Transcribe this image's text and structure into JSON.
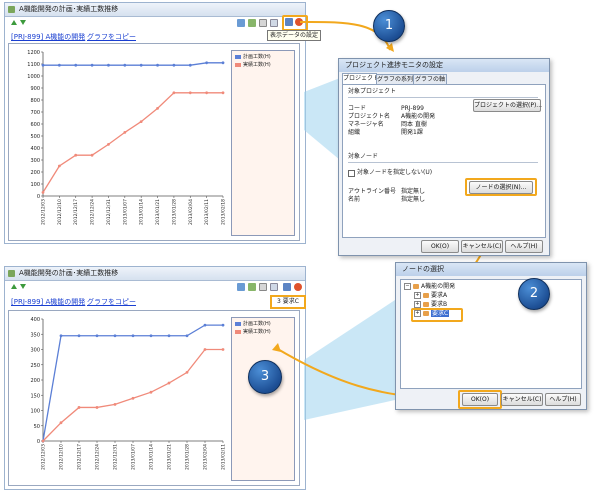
{
  "panel1": {
    "title": "A機能開発の計画･実績工数推移",
    "link_prj": "[PRJ-899] A機能の開発",
    "link_copy": "グラフをコピー",
    "tooltip": "表示データの設定"
  },
  "panel2": {
    "title": "A機能開発の計画･実績工数推移",
    "link_prj": "[PRJ-899] A機能の開発",
    "link_copy": "グラフをコピー",
    "node_badge": "3 要求C"
  },
  "chart_data": [
    {
      "type": "line",
      "x": [
        "2012/12/03",
        "2012/12/10",
        "2012/12/17",
        "2012/12/24",
        "2012/12/31",
        "2013/01/07",
        "2013/01/14",
        "2013/01/21",
        "2013/01/28",
        "2013/02/04",
        "2013/02/11",
        "2013/02/18"
      ],
      "series": [
        {
          "name": "計画工数(H)",
          "color": "#5b7fd6",
          "values": [
            1090,
            1090,
            1090,
            1090,
            1090,
            1090,
            1090,
            1090,
            1090,
            1090,
            1110,
            1110
          ]
        },
        {
          "name": "実績工数(H)",
          "color": "#f08a7a",
          "values": [
            30,
            250,
            340,
            340,
            430,
            530,
            620,
            730,
            860,
            860,
            860,
            860
          ]
        }
      ],
      "ylim": [
        0,
        1200
      ],
      "yticks": [
        "0",
        "100",
        "200",
        "300",
        "400",
        "500",
        "600",
        "700",
        "800",
        "900",
        "1000",
        "1100",
        "1200"
      ],
      "legend": "right",
      "grid": false
    },
    {
      "type": "line",
      "x": [
        "2012/12/03",
        "2012/12/10",
        "2012/12/17",
        "2012/12/24",
        "2012/12/31",
        "2013/01/07",
        "2013/01/14",
        "2013/01/21",
        "2013/01/28",
        "2013/02/04",
        "2013/02/11"
      ],
      "series": [
        {
          "name": "計画工数(H)",
          "color": "#5b7fd6",
          "values": [
            0,
            345,
            345,
            345,
            345,
            345,
            345,
            345,
            345,
            380,
            380
          ]
        },
        {
          "name": "実績工数(H)",
          "color": "#f08a7a",
          "values": [
            0,
            60,
            110,
            110,
            120,
            140,
            160,
            190,
            225,
            300,
            300
          ]
        }
      ],
      "ylim": [
        0,
        400
      ],
      "yticks": [
        "0",
        "50",
        "100",
        "150",
        "200",
        "250",
        "300",
        "350",
        "400"
      ],
      "legend": "right",
      "grid": false
    }
  ],
  "dialog_settings": {
    "title": "プロジェクト進捗モニタの設定",
    "tabs": [
      "プロジェクト",
      "グラフの系列",
      "グラフの軸"
    ],
    "section_project": "対象プロジェクト",
    "select_project_btn": "プロジェクトの選択(P)...",
    "rows": [
      {
        "label": "コード",
        "value": "PRJ-899"
      },
      {
        "label": "プロジェクト名",
        "value": "A機能の開発"
      },
      {
        "label": "マネージャ名",
        "value": "岡本 直樹"
      },
      {
        "label": "組織",
        "value": "開発1課"
      }
    ],
    "section_node": "対象ノード",
    "no_node_checkbox": "対象ノードを指定しない(U)",
    "node_rows": [
      {
        "label": "アウトライン番号",
        "value": "指定無し"
      },
      {
        "label": "名前",
        "value": "指定無し"
      }
    ],
    "select_node_btn": "ノードの選択(N)...",
    "ok": "OK(O)",
    "cancel": "キャンセル(C)",
    "help": "ヘルプ(H)"
  },
  "dialog_node": {
    "title": "ノードの選択",
    "tree": [
      {
        "label": "A機能の開発"
      },
      {
        "label": "要求A"
      },
      {
        "label": "要求B"
      },
      {
        "label": "要求C"
      }
    ],
    "ok": "OK(O)",
    "cancel": "キャンセル(C)",
    "help": "ヘルプ(H)"
  },
  "steps": [
    "1",
    "2",
    "3"
  ]
}
